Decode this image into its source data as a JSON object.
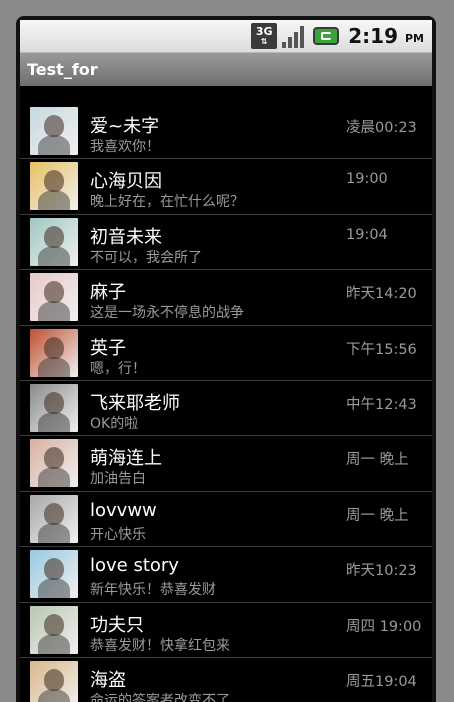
{
  "status_bar": {
    "network_icon": "3g-network-icon",
    "network_label": "3G",
    "signal_icon": "signal-strength-icon",
    "battery_icon": "battery-charging-icon",
    "time": "2:19",
    "ampm": "PM"
  },
  "app": {
    "title": "Test_for"
  },
  "colors": {
    "status_bar": "#e8e8e8",
    "title_bar": "#7f7f7f",
    "list_bg": "#000000",
    "secondary_text": "#9a9a9a"
  },
  "conversations": [
    {
      "name": "爱~未字",
      "message": "我喜欢你！",
      "time": "凌晨00:23",
      "avatar_color": "#c8d8e0"
    },
    {
      "name": "心海贝因",
      "message": "晚上好在，在忙什么呢？",
      "time": "19:00",
      "avatar_color": "#e8c060"
    },
    {
      "name": "初音未来",
      "message": "不可以，我会所了",
      "time": "19:04",
      "avatar_color": "#9fc8c0"
    },
    {
      "name": "麻子",
      "message": "这是一场永不停息的战争",
      "time": "昨天14:20",
      "avatar_color": "#e8c8c8"
    },
    {
      "name": "英子",
      "message": "嗯，行！",
      "time": "下午15:56",
      "avatar_color": "#c05030"
    },
    {
      "name": "飞来耶老师",
      "message": "OK的啦",
      "time": "中午12:43",
      "avatar_color": "#8a8a8a"
    },
    {
      "name": "萌海连上",
      "message": "加油告白",
      "time": "周一 晚上",
      "avatar_color": "#d8b0a0"
    },
    {
      "name": "lovvww",
      "message": "开心快乐",
      "time": "周一 晚上",
      "avatar_color": "#a8a8a8"
    },
    {
      "name": "love story",
      "message": "新年快乐！恭喜发财",
      "time": "昨天10:23",
      "avatar_color": "#98c8e0"
    },
    {
      "name": "功夫只",
      "message": "恭喜发财！快拿红包来",
      "time": "周四 19:00",
      "avatar_color": "#b8c8b0"
    },
    {
      "name": "海盗",
      "message": "命运的答案者改变不了",
      "time": "周五19:04",
      "avatar_color": "#d8b888"
    }
  ]
}
